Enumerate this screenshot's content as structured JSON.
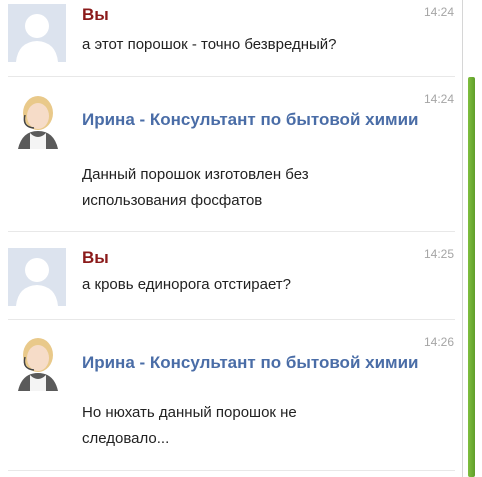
{
  "messages": [
    {
      "sender": "Вы",
      "time": "14:24",
      "lines": [
        "а этот порошок - точно безвредный?"
      ]
    },
    {
      "sender": "Ирина - Консультант по бытовой химии",
      "time": "14:24",
      "lines": [
        "Данный порошок изготовлен без",
        "использования фосфатов"
      ]
    },
    {
      "sender": "Вы",
      "time": "14:25",
      "lines": [
        "а кровь единорога отстирает?"
      ]
    },
    {
      "sender": "Ирина - Консультант по бытовой химии",
      "time": "14:26",
      "lines": [
        "Но нюхать данный порошок не",
        "следовало..."
      ]
    }
  ],
  "colors": {
    "user_name": "#8b1a1a",
    "bot_name": "#4a6da7",
    "scroll_thumb": "#6aad32"
  }
}
